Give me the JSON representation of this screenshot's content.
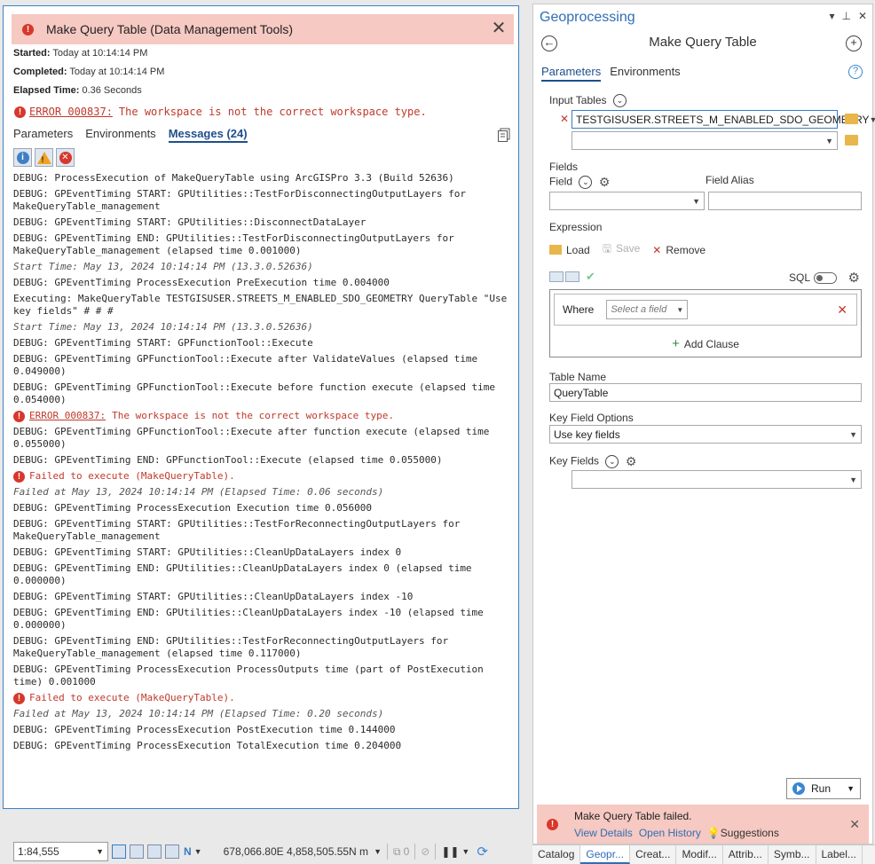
{
  "message_dialog": {
    "title": "Make Query Table (Data Management Tools)",
    "started_label": "Started:",
    "started_value": "Today at 10:14:14 PM",
    "completed_label": "Completed:",
    "completed_value": "Today at 10:14:14 PM",
    "elapsed_label": "Elapsed Time:",
    "elapsed_value": "0.36 Seconds",
    "error_code": "ERROR 000837:",
    "error_text": "The workspace is not the correct workspace type.",
    "tabs": [
      "Parameters",
      "Environments",
      "Messages (24)"
    ],
    "messages": [
      {
        "t": "DEBUG: ProcessExecution of MakeQueryTable using ArcGISPro 3.3 (Build 52636)"
      },
      {
        "t": "DEBUG: GPEventTiming START: GPUtilities::TestForDisconnectingOutputLayers for\nMakeQueryTable_management"
      },
      {
        "t": "DEBUG: GPEventTiming START: GPUtilities::DisconnectDataLayer"
      },
      {
        "t": "DEBUG: GPEventTiming END: GPUtilities::TestForDisconnectingOutputLayers for\nMakeQueryTable_management (elapsed time 0.001000)"
      },
      {
        "t": "Start Time: May 13, 2024 10:14:14 PM (13.3.0.52636)",
        "style": "it"
      },
      {
        "t": "DEBUG: GPEventTiming ProcessExecution PreExecution time 0.004000"
      },
      {
        "t": "Executing: MakeQueryTable TESTGISUSER.STREETS_M_ENABLED_SDO_GEOMETRY QueryTable \"Use\nkey fields\" # # #"
      },
      {
        "t": "Start Time: May 13, 2024 10:14:14 PM (13.3.0.52636)",
        "style": "it"
      },
      {
        "t": "DEBUG: GPEventTiming START: GPFunctionTool::Execute"
      },
      {
        "t": "DEBUG: GPEventTiming GPFunctionTool::Execute after ValidateValues (elapsed time\n0.049000)"
      },
      {
        "t": "DEBUG: GPEventTiming GPFunctionTool::Execute before function execute (elapsed time\n0.054000)"
      },
      {
        "t": "The workspace is not the correct workspace type.",
        "code": "ERROR 000837:",
        "style": "error"
      },
      {
        "t": "DEBUG: GPEventTiming GPFunctionTool::Execute after function execute (elapsed time\n0.055000)"
      },
      {
        "t": "DEBUG: GPEventTiming END: GPFunctionTool::Execute (elapsed time 0.055000)"
      },
      {
        "t": "Failed to execute (MakeQueryTable).",
        "style": "error"
      },
      {
        "t": "Failed at May 13, 2024 10:14:14 PM (Elapsed Time: 0.06 seconds)",
        "style": "it"
      },
      {
        "t": "DEBUG: GPEventTiming ProcessExecution Execution time 0.056000"
      },
      {
        "t": "DEBUG: GPEventTiming START: GPUtilities::TestForReconnectingOutputLayers for\nMakeQueryTable_management"
      },
      {
        "t": "DEBUG: GPEventTiming START: GPUtilities::CleanUpDataLayers index 0"
      },
      {
        "t": "DEBUG: GPEventTiming END: GPUtilities::CleanUpDataLayers index 0 (elapsed time\n0.000000)"
      },
      {
        "t": "DEBUG: GPEventTiming START: GPUtilities::CleanUpDataLayers index -10"
      },
      {
        "t": "DEBUG: GPEventTiming END: GPUtilities::CleanUpDataLayers index -10 (elapsed time\n0.000000)"
      },
      {
        "t": "DEBUG: GPEventTiming END: GPUtilities::TestForReconnectingOutputLayers for\nMakeQueryTable_management (elapsed time 0.117000)"
      },
      {
        "t": "DEBUG: GPEventTiming ProcessExecution ProcessOutputs time (part of PostExecution\ntime) 0.001000"
      },
      {
        "t": "Failed to execute (MakeQueryTable).",
        "style": "error"
      },
      {
        "t": "Failed at May 13, 2024 10:14:14 PM (Elapsed Time: 0.20 seconds)",
        "style": "it"
      },
      {
        "t": "DEBUG: GPEventTiming ProcessExecution PostExecution time 0.144000"
      },
      {
        "t": "DEBUG: GPEventTiming ProcessExecution TotalExecution time 0.204000"
      }
    ]
  },
  "status_bar": {
    "scale": "1:84,555",
    "coordinates": "678,066.80E 4,858,505.55N m",
    "selected_count": "0"
  },
  "geoprocessing": {
    "pane_title": "Geoprocessing",
    "tool_title": "Make Query Table",
    "tabs": [
      "Parameters",
      "Environments"
    ],
    "input_tables_label": "Input Tables",
    "input_table_value": "TESTGISUSER.STREETS_M_ENABLED_SDO_GEOMETRY",
    "fields_label": "Fields",
    "field_label": "Field",
    "field_alias_label": "Field Alias",
    "expression_label": "Expression",
    "load_label": "Load",
    "save_label": "Save",
    "remove_label": "Remove",
    "sql_label": "SQL",
    "where_label": "Where",
    "select_field_placeholder": "Select a field",
    "add_clause_label": "Add Clause",
    "table_name_label": "Table Name",
    "table_name_value": "QueryTable",
    "key_field_options_label": "Key Field Options",
    "key_field_options_value": "Use key fields",
    "key_fields_label": "Key Fields",
    "run_label": "Run",
    "notice_text": "Make Query Table failed.",
    "notice_links": [
      "View Details",
      "Open History",
      "Suggestions"
    ]
  },
  "bottom_tabs": [
    "Catalog",
    "Geopr...",
    "Creat...",
    "Modif...",
    "Attrib...",
    "Symb...",
    "Label..."
  ],
  "colors": {
    "error": "#d8372b",
    "accent": "#2f6eb5",
    "error_banner": "#f6c9c2"
  }
}
